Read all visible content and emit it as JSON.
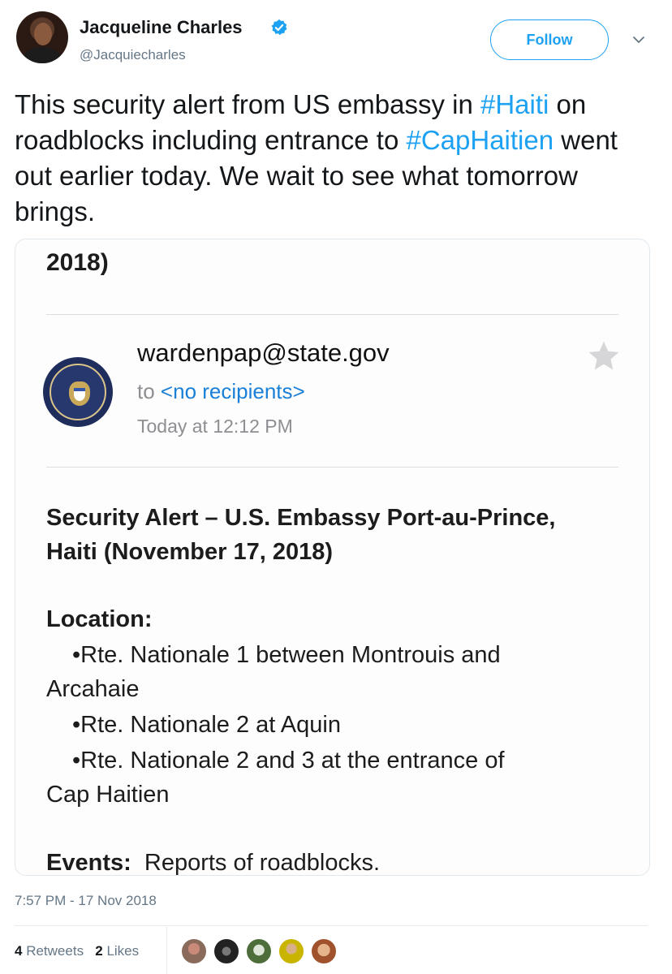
{
  "user": {
    "name": "Jacqueline Charles",
    "handle": "@Jacquiecharles",
    "follow_label": "Follow",
    "verified_icon": "verified-badge-icon",
    "verified_color": "#1da1f2"
  },
  "tweet": {
    "segments": [
      {
        "text": "This security alert from US embassy in ",
        "type": "text"
      },
      {
        "text": "#Haiti",
        "type": "hashtag"
      },
      {
        "text": " on roadblocks including entrance to ",
        "type": "text"
      },
      {
        "text": "#CapHaitien",
        "type": "hashtag"
      },
      {
        "text": " went out  earlier today. We wait to see what tomorrow brings.",
        "type": "text"
      }
    ],
    "hashtag_color": "#1da1f2"
  },
  "email": {
    "top_fragment": "2018)",
    "sender": "wardenpap@state.gov",
    "to_prefix": "to ",
    "recipients": "<no recipients>",
    "time": "Today at 12:12 PM",
    "title": "Security Alert – U.S. Embassy Port-au-Prince, Haiti (November 17,  2018)",
    "location_label": "Location:",
    "locations": [
      "•Rte. Nationale 1 between Montrouis and",
      "Arcahaie",
      "•Rte. Nationale 2 at Aquin",
      "•Rte. Nationale 2 and 3 at the entrance of",
      "Cap Haitien"
    ],
    "events_label": "Events:",
    "events_text": "Reports of roadblocks."
  },
  "footer": {
    "timestamp": "7:57 PM - 17 Nov 2018",
    "retweets_count": "4",
    "retweets_label": "Retweets",
    "likes_count": "2",
    "likes_label": "Likes"
  }
}
